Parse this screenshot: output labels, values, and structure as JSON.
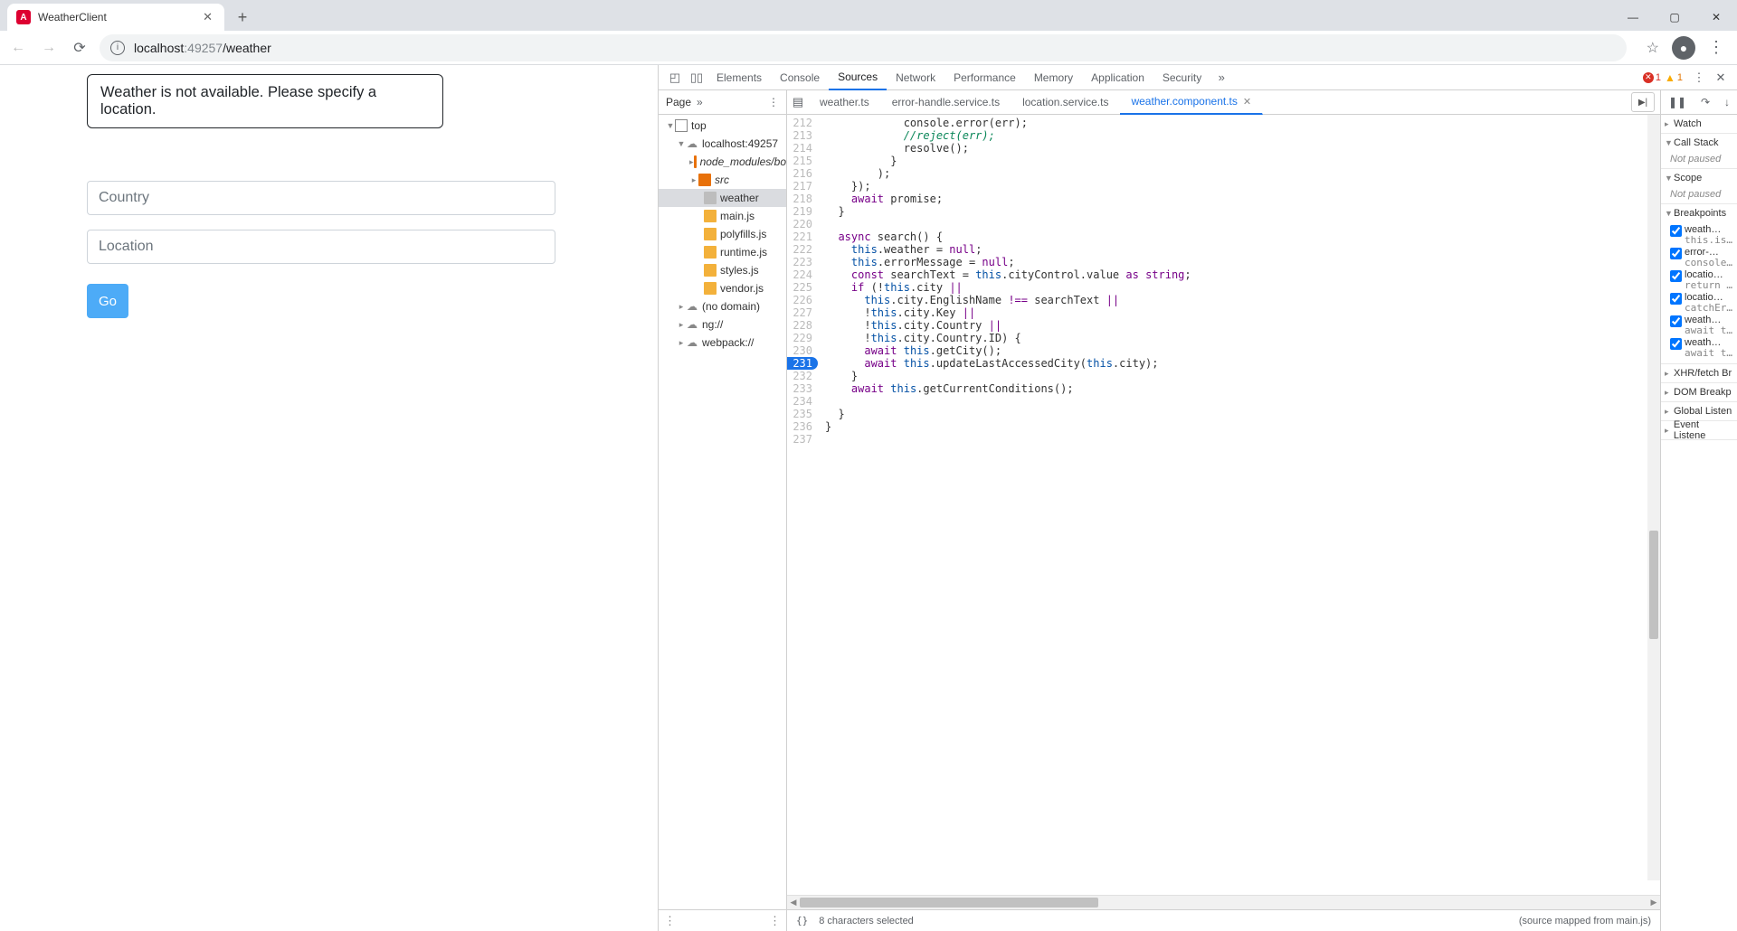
{
  "browser": {
    "tab_title": "WeatherClient",
    "url_host": "localhost",
    "url_port": ":49257",
    "url_path": "/weather"
  },
  "page": {
    "message": "Weather is not available. Please specify a location.",
    "country_placeholder": "Country",
    "location_placeholder": "Location",
    "go_label": "Go"
  },
  "devtools": {
    "tabs": [
      "Elements",
      "Console",
      "Sources",
      "Network",
      "Performance",
      "Memory",
      "Application",
      "Security"
    ],
    "active_tab": "Sources",
    "errors": "1",
    "warnings": "1",
    "nav_header": "Page",
    "tree": {
      "top": "top",
      "domain": "localhost:49257",
      "node_modules": "node_modules/bo",
      "src": "src",
      "files": [
        "weather",
        "main.js",
        "polyfills.js",
        "runtime.js",
        "styles.js",
        "vendor.js"
      ],
      "nodomain": "(no domain)",
      "ng": "ng://",
      "webpack": "webpack://"
    },
    "file_tabs": [
      "weather.ts",
      "error-handle.service.ts",
      "location.service.ts",
      "weather.component.ts"
    ],
    "active_file": "weather.component.ts",
    "code_lines": [
      {
        "n": 212,
        "t": "            console.error(err);"
      },
      {
        "n": 213,
        "t": "            //reject(err);",
        "cm": true
      },
      {
        "n": 214,
        "t": "            resolve();"
      },
      {
        "n": 215,
        "t": "          }"
      },
      {
        "n": 216,
        "t": "        );"
      },
      {
        "n": 217,
        "t": "    });"
      },
      {
        "n": 218,
        "t": "    await promise;"
      },
      {
        "n": 219,
        "t": "  }"
      },
      {
        "n": 220,
        "t": ""
      },
      {
        "n": 221,
        "t": "  async search() {"
      },
      {
        "n": 222,
        "t": "    this.weather = null;"
      },
      {
        "n": 223,
        "t": "    this.errorMessage = null;"
      },
      {
        "n": 224,
        "t": "    const searchText = this.cityControl.value as string;"
      },
      {
        "n": 225,
        "t": "    if (!this.city ||"
      },
      {
        "n": 226,
        "t": "      this.city.EnglishName !== searchText ||"
      },
      {
        "n": 227,
        "t": "      !this.city.Key ||"
      },
      {
        "n": 228,
        "t": "      !this.city.Country ||"
      },
      {
        "n": 229,
        "t": "      !this.city.Country.ID) {"
      },
      {
        "n": 230,
        "t": "      await this.getCity();"
      },
      {
        "n": 231,
        "t": "      await this.updateLastAccessedCity(this.city);",
        "bp": true
      },
      {
        "n": 232,
        "t": "    }"
      },
      {
        "n": 233,
        "t": "    await this.getCurrentConditions();"
      },
      {
        "n": 234,
        "t": ""
      },
      {
        "n": 235,
        "t": "  }"
      },
      {
        "n": 236,
        "t": "}"
      },
      {
        "n": 237,
        "t": ""
      }
    ],
    "status_left": "8 characters selected",
    "status_right": "(source mapped from main.js)",
    "debug": {
      "watch": "Watch",
      "callstack": "Call Stack",
      "not_paused": "Not paused",
      "scope": "Scope",
      "breakpoints_hd": "Breakpoints",
      "breakpoints": [
        {
          "l1": "weath…",
          "l2": "this.isDa…"
        },
        {
          "l1": "error-…",
          "l2": "console.e…"
        },
        {
          "l1": "locatio…",
          "l2": "return th…"
        },
        {
          "l1": "locatio…",
          "l2": "catchErro…"
        },
        {
          "l1": "weath…",
          "l2": "await thi…"
        },
        {
          "l1": "weath…",
          "l2": "await thi…"
        }
      ],
      "xhr": "XHR/fetch Br",
      "dom": "DOM Breakp",
      "global": "Global Listen",
      "event": "Event Listene"
    }
  }
}
